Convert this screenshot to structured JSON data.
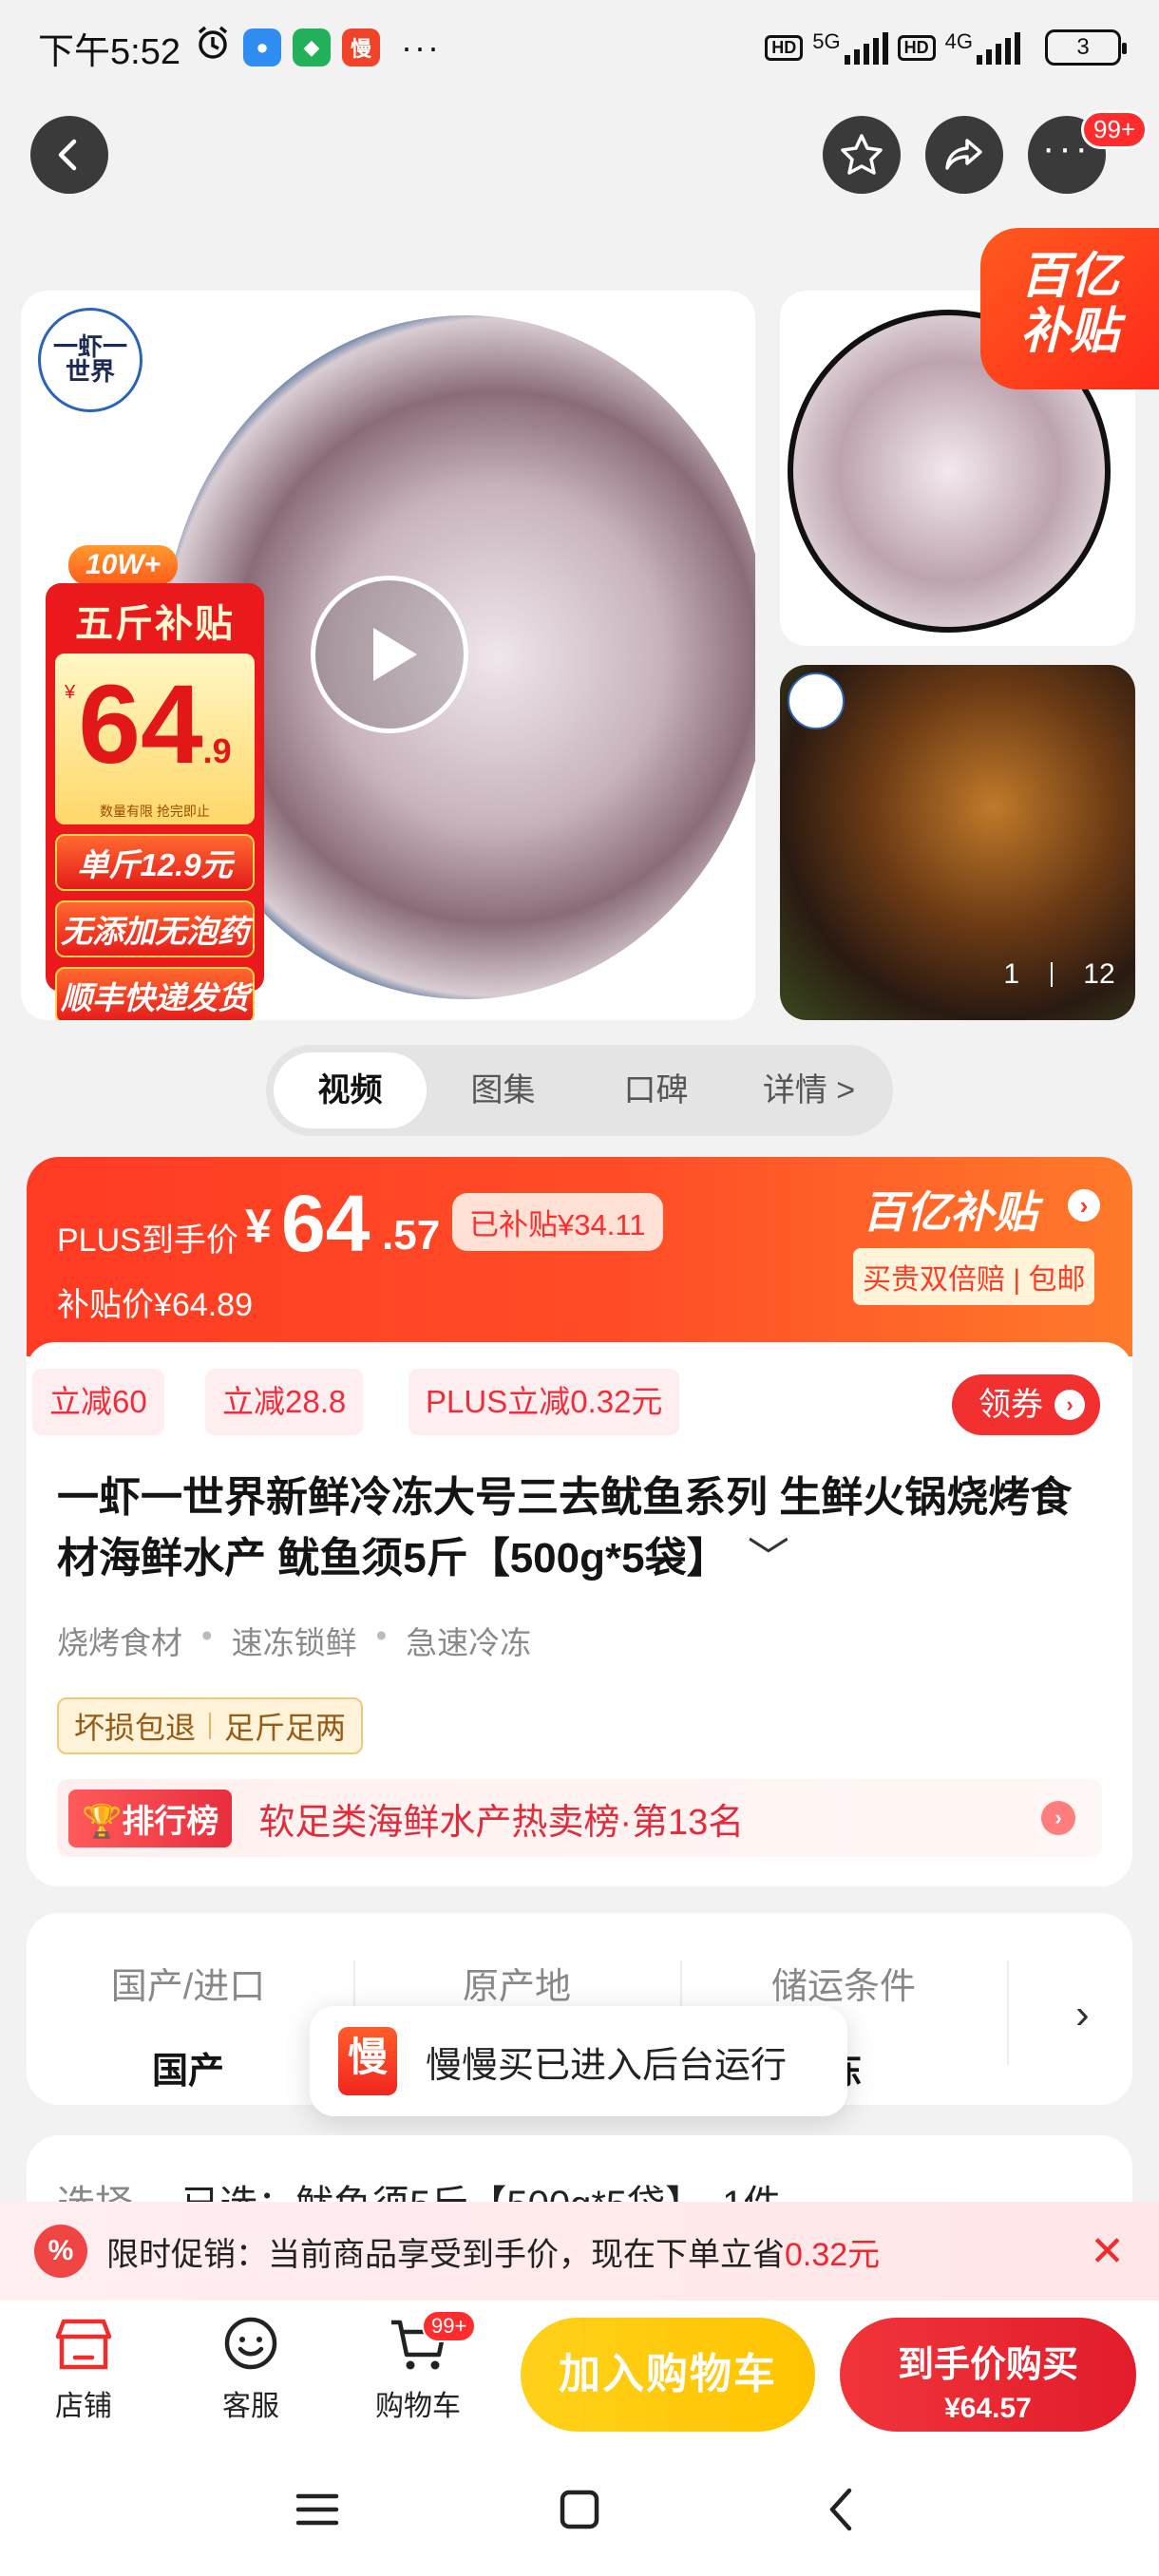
{
  "status_bar": {
    "time": "下午5:52",
    "more": "···",
    "net1": "5G",
    "net2": "4G",
    "hd": "HD",
    "battery": "3"
  },
  "top_nav": {
    "more_badge": "99+"
  },
  "gallery": {
    "brand_logo": "一虾一世界",
    "hot_tag": "10W+",
    "promo_head": "五斤补贴",
    "promo_price_int": "64",
    "promo_price_dec": ".9",
    "promo_currency": "¥",
    "promo_note": "数量有限 抢完即止",
    "promo_lines": [
      "单斤12.9元",
      "无添加无泡药",
      "顺丰快递发货"
    ],
    "yi_badge_line1": "百亿",
    "yi_badge_line2": "补贴",
    "counter_current": "1",
    "counter_total": "12"
  },
  "tabs": [
    "视频",
    "图集",
    "口碑",
    "详情 >"
  ],
  "price": {
    "plus_label": "PLUS到手价",
    "currency": "¥",
    "int": "64",
    "dec": ".57",
    "subsidized": "已补贴¥34.11",
    "original": "补贴价¥64.89",
    "yi_title": "百亿补贴",
    "yi_tag": "买贵双倍赔 | 包邮"
  },
  "coupons": [
    "立减60",
    "立减28.8",
    "PLUS立减0.32元"
  ],
  "get_coupon": "领券",
  "product": {
    "title": "一虾一世界新鲜冷冻大号三去鱿鱼系列 生鲜火锅烧烤食材海鲜水产 鱿鱼须5斤【500g*5袋】",
    "expand": "﹀",
    "attributes": [
      "烧烤食材",
      "速冻锁鲜",
      "急速冷冻"
    ],
    "guarantees": [
      "坏损包退",
      "足斤足两"
    ]
  },
  "rank": {
    "badge": "排行榜",
    "text": "软足类海鲜水产热卖榜·第13名"
  },
  "params": [
    {
      "label": "国产/进口",
      "value": "国产"
    },
    {
      "label": "原产地",
      "value": ""
    },
    {
      "label": "储运条件",
      "value": "冻"
    }
  ],
  "toast": {
    "icon": "慢",
    "text": "慢慢买已进入后台运行"
  },
  "select_row": {
    "label": "选择",
    "value": "已选：鱿鱼须5斤【500g*5袋】，1件"
  },
  "promo_bar": {
    "icon": "%",
    "text": "限时促销：当前商品享受到手价，现在下单立省",
    "highlight": "0.32元",
    "close": "✕"
  },
  "action_bar": {
    "shop": "店铺",
    "service": "客服",
    "cart": "购物车",
    "cart_badge": "99+",
    "add_to_cart": "加入购物车",
    "buy_line1": "到手价购买",
    "buy_line2": "¥64.57"
  },
  "colors": {
    "accent_red": "#ff3b23",
    "buy_red": "#e21c2c",
    "cart_yellow": "#ffc400"
  }
}
